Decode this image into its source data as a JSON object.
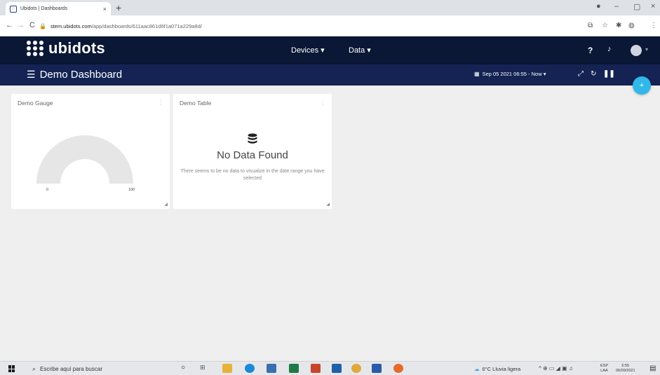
{
  "browser": {
    "tab_title": "Ubidots | Dashboards",
    "tab_close": "×",
    "new_tab": "+",
    "url_host": "stem.ubidots.com",
    "url_path": "/app/dashboards/611aac861d6f1a071a229a8d/",
    "back": "←",
    "forward": "→",
    "reload": "C",
    "window_controls": [
      "–",
      "▢",
      "×"
    ]
  },
  "header": {
    "logo_text": "ubidots",
    "nav": [
      "Devices ▾",
      "Data ▾"
    ],
    "help_icon": "?",
    "bell_icon": "🔔"
  },
  "dashboard": {
    "title": "Demo Dashboard",
    "date_range": "Sep 05 2021 06:55 - Now ▾",
    "fab_label": "+"
  },
  "widgets": {
    "gauge": {
      "title": "Demo Gauge",
      "min_label": "0",
      "max_label": "100",
      "color": "#e6e6e6"
    },
    "table": {
      "title": "Demo Table",
      "empty_title": "No Data Found",
      "empty_desc": "There seems to be no data to visualize in the date range you have selected"
    }
  },
  "taskbar": {
    "search_placeholder": "Escribe aquí para buscar",
    "weather": "6°C  Lluvia ligera",
    "lang_line1": "ESP",
    "lang_line2": "LAA",
    "time": "6:55",
    "date": "06/09/2021"
  },
  "colors": {
    "nav_bg": "#0a1735",
    "dashbar_bg": "#142353",
    "accent": "#2fb8e8"
  }
}
